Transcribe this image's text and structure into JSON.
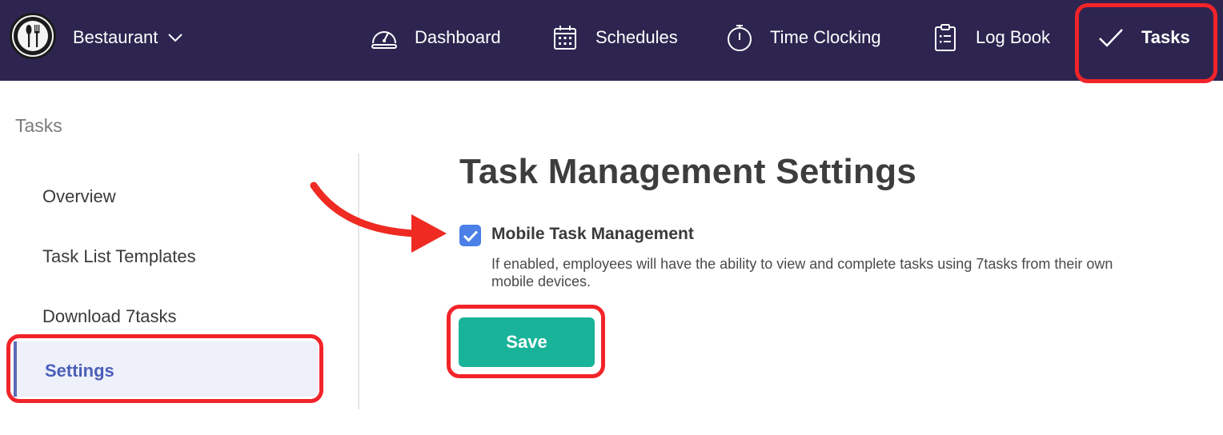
{
  "header": {
    "brand_name": "Bestaurant",
    "nav": [
      {
        "label": "Dashboard",
        "icon": "dashboard-icon"
      },
      {
        "label": "Schedules",
        "icon": "calendar-icon"
      },
      {
        "label": "Time Clocking",
        "icon": "stopwatch-icon"
      },
      {
        "label": "Log Book",
        "icon": "clipboard-icon"
      },
      {
        "label": "Tasks",
        "icon": "check-icon",
        "active": true
      }
    ]
  },
  "page": {
    "section_title": "Tasks"
  },
  "sidebar": {
    "items": [
      {
        "label": "Overview"
      },
      {
        "label": "Task List Templates"
      },
      {
        "label": "Download 7tasks"
      },
      {
        "label": "Settings",
        "active": true
      }
    ]
  },
  "main": {
    "title": "Task Management Settings",
    "mobile_task_management": {
      "label": "Mobile Task Management",
      "checked": true,
      "description": "If enabled, employees will have the ability to view and complete tasks using 7tasks from their own mobile devices."
    },
    "save_label": "Save"
  },
  "colors": {
    "header_bg": "#2d2550",
    "highlight": "#f2242a",
    "save_button": "#19b39a",
    "checkbox": "#4a80e8",
    "active_sidebar_text": "#4a5fb8"
  }
}
